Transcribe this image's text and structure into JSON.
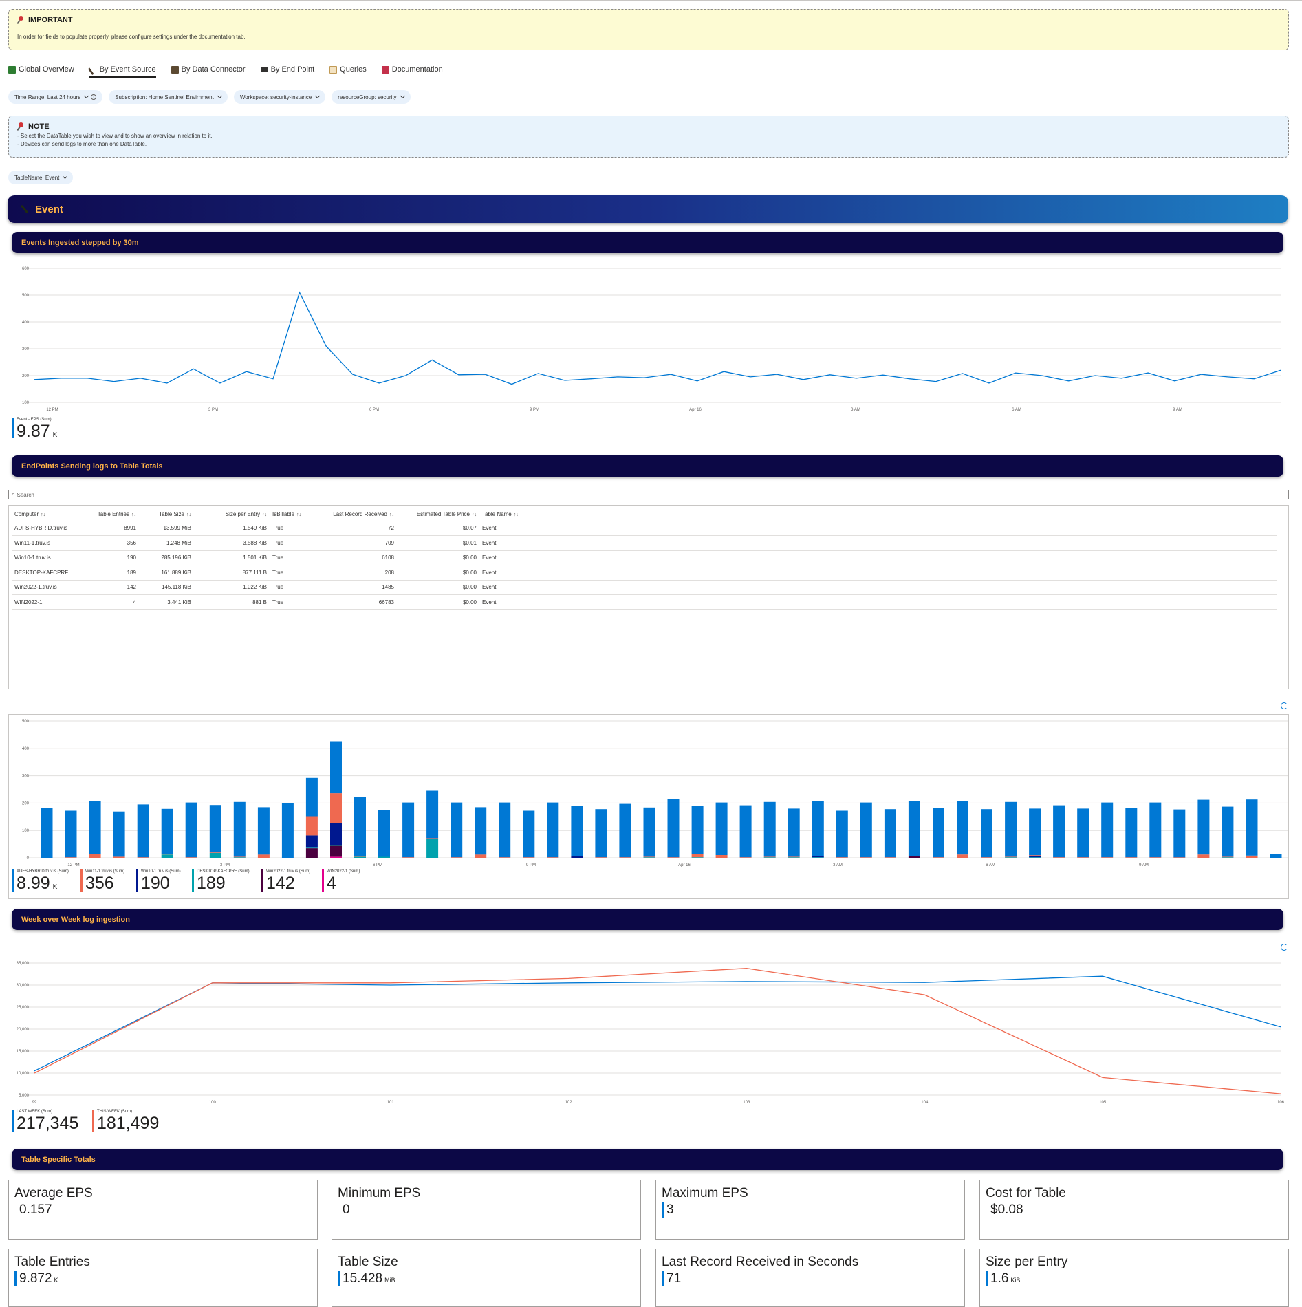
{
  "important": {
    "heading": "IMPORTANT",
    "text": "In order for fields to populate properly, please configure settings under the documentation tab."
  },
  "tabs": [
    {
      "label": "Global Overview",
      "icon": "chart-icon",
      "color": "#2e7d32"
    },
    {
      "label": "By Event Source",
      "icon": "feather-icon",
      "color": "#4a3b2a"
    },
    {
      "label": "By Data Connector",
      "icon": "connector-icon",
      "color": "#5c4a32"
    },
    {
      "label": "By End Point",
      "icon": "monitor-icon",
      "color": "#323130"
    },
    {
      "label": "Queries",
      "icon": "scroll-icon",
      "color": "#c19a55"
    },
    {
      "label": "Documentation",
      "icon": "book-icon",
      "color": "#c4314b"
    }
  ],
  "params": {
    "time_range": "Time Range: Last 24 hours",
    "subscription": "Subscription: Home Sentinel Envirnment",
    "workspace": "Workspace: security-instance",
    "resource_group": "resourceGroup: security"
  },
  "note": {
    "heading": "NOTE",
    "line1": "- Select the DataTable you wish to view and to show an overview in relation to it.",
    "line2": "- Devices can send logs to more than one DataTable."
  },
  "table_param": "TableName: Event",
  "event_title": "Event",
  "sections": {
    "ingested": "Events Ingested stepped by 30m",
    "endpoints": "EndPoints Sending logs to Table Totals",
    "week": "Week over Week log ingestion",
    "specific": "Table Specific Totals"
  },
  "colors": {
    "accent": "#0078d4",
    "section_bg": "#0c0846",
    "section_text": "#ffb347",
    "series": [
      "#0078d4",
      "#ef6950",
      "#00188f",
      "#00a2ad",
      "#4b003f",
      "#e3008c"
    ]
  },
  "chart_data": [
    {
      "type": "line",
      "title": "",
      "ylim": [
        100,
        600
      ],
      "yticks": [
        "600",
        "500",
        "400",
        "300",
        "200",
        "100"
      ],
      "xtick_labels": [
        "12 PM",
        "3 PM",
        "6 PM",
        "9 PM",
        "Apr 16",
        "3 AM",
        "6 AM",
        "9 AM"
      ],
      "series": [
        {
          "name": "Event - EPS (Sum)",
          "values": [
            185,
            190,
            190,
            178,
            190,
            172,
            225,
            172,
            215,
            188,
            510,
            310,
            205,
            172,
            200,
            258,
            203,
            205,
            168,
            208,
            182,
            188,
            195,
            192,
            205,
            180,
            215,
            195,
            205,
            185,
            203,
            190,
            202,
            188,
            178,
            208,
            172,
            210,
            200,
            180,
            200,
            190,
            210,
            180,
            205,
            195,
            188,
            220
          ]
        }
      ],
      "summary": {
        "label": "Event - EPS (Sum)",
        "value": "9.87",
        "unit": "K"
      }
    },
    {
      "type": "bar",
      "stacked": true,
      "ylim": [
        0,
        500
      ],
      "yticks": [
        "500",
        "400",
        "300",
        "200",
        "100",
        "0"
      ],
      "xtick_labels": [
        "12 PM",
        "3 PM",
        "6 PM",
        "9 PM",
        "Apr 16",
        "3 AM",
        "6 AM",
        "9 AM"
      ],
      "series": [
        {
          "name": "ADFS-HYBRID.truv.is (Sum)",
          "values": [
            183,
            170,
            193,
            165,
            193,
            165,
            200,
            173,
            200,
            173,
            200,
            140,
            190,
            215,
            172,
            200,
            173,
            200,
            173,
            200,
            170,
            200,
            182,
            176,
            195,
            180,
            212,
            176,
            192,
            190,
            200,
            176,
            200,
            170,
            200,
            176,
            200,
            180,
            195,
            176,
            200,
            170,
            190,
            178,
            200,
            180,
            200,
            175,
            200,
            183,
            205,
            15
          ]
        },
        {
          "name": "Win11-1.truv.is (Sum)",
          "values": [
            0,
            2,
            15,
            4,
            2,
            2,
            2,
            2,
            2,
            12,
            0,
            70,
            110,
            2,
            0,
            2,
            2,
            2,
            12,
            2,
            2,
            2,
            2,
            2,
            2,
            2,
            2,
            12,
            10,
            2,
            2,
            2,
            2,
            2,
            2,
            2,
            2,
            2,
            12,
            2,
            2,
            2,
            2,
            2,
            2,
            2,
            2,
            2,
            12,
            2,
            8,
            0
          ]
        },
        {
          "name": "Win10-1.truv.is (Sum)",
          "values": [
            0,
            0,
            0,
            0,
            0,
            0,
            0,
            0,
            0,
            0,
            0,
            45,
            80,
            0,
            0,
            0,
            0,
            0,
            0,
            0,
            0,
            0,
            5,
            0,
            0,
            0,
            0,
            0,
            0,
            0,
            0,
            0,
            3,
            0,
            0,
            0,
            0,
            0,
            0,
            0,
            0,
            6,
            0,
            0,
            0,
            0,
            0,
            0,
            0,
            0,
            0,
            0
          ]
        },
        {
          "name": "DESKTOP-KAFCPRF (Sum)",
          "values": [
            0,
            0,
            0,
            0,
            0,
            12,
            0,
            18,
            2,
            0,
            0,
            2,
            2,
            4,
            4,
            0,
            70,
            0,
            0,
            0,
            0,
            0,
            0,
            0,
            0,
            2,
            0,
            2,
            0,
            0,
            2,
            2,
            2,
            0,
            0,
            0,
            0,
            0,
            0,
            0,
            2,
            2,
            0,
            0,
            0,
            0,
            0,
            0,
            0,
            2,
            0,
            0
          ]
        },
        {
          "name": "Win2022-1.truv.is (Sum)",
          "values": [
            0,
            0,
            0,
            0,
            0,
            0,
            0,
            0,
            0,
            0,
            0,
            35,
            40,
            0,
            0,
            0,
            0,
            0,
            0,
            0,
            0,
            0,
            0,
            0,
            0,
            0,
            0,
            0,
            0,
            0,
            0,
            0,
            0,
            0,
            0,
            0,
            5,
            0,
            0,
            0,
            0,
            0,
            0,
            0,
            0,
            0,
            0,
            0,
            0,
            0,
            0,
            0
          ]
        },
        {
          "name": "WIN2022-1 (Sum)",
          "values": [
            0,
            0,
            0,
            0,
            0,
            0,
            0,
            0,
            0,
            0,
            0,
            0,
            4,
            0,
            0,
            0,
            0,
            0,
            0,
            0,
            0,
            0,
            0,
            0,
            0,
            0,
            0,
            0,
            0,
            0,
            0,
            0,
            0,
            0,
            0,
            0,
            0,
            0,
            0,
            0,
            0,
            0,
            0,
            0,
            0,
            0,
            0,
            0,
            0,
            0,
            0,
            0
          ]
        }
      ],
      "summary": [
        {
          "label": "ADFS-HYBRID.truv.is (Sum)",
          "value": "8.99",
          "unit": "K"
        },
        {
          "label": "Win11-1.truv.is (Sum)",
          "value": "356",
          "unit": ""
        },
        {
          "label": "Win10-1.truv.is (Sum)",
          "value": "190",
          "unit": ""
        },
        {
          "label": "DESKTOP-KAFCPRF (Sum)",
          "value": "189",
          "unit": ""
        },
        {
          "label": "Win2022-1.truv.is (Sum)",
          "value": "142",
          "unit": ""
        },
        {
          "label": "WIN2022-1 (Sum)",
          "value": "4",
          "unit": ""
        }
      ]
    },
    {
      "type": "line",
      "ylim": [
        5000,
        35000
      ],
      "yticks": [
        "35,000",
        "30,000",
        "25,000",
        "20,000",
        "15,000",
        "10,000",
        "5,000"
      ],
      "x": [
        99,
        100,
        101,
        102,
        103,
        104,
        105,
        106
      ],
      "series": [
        {
          "name": "LAST WEEK (Sum)",
          "values": [
            10500,
            30500,
            30000,
            30500,
            30800,
            30600,
            32000,
            20500
          ]
        },
        {
          "name": "THIS WEEK (Sum)",
          "values": [
            10000,
            30500,
            30500,
            31500,
            33800,
            27800,
            9000,
            5300
          ]
        }
      ],
      "summary": [
        {
          "label": "LAST WEEK (Sum)",
          "value": "217,345"
        },
        {
          "label": "THIS WEEK (Sum)",
          "value": "181,499"
        }
      ]
    }
  ],
  "table": {
    "search_placeholder": "Search",
    "columns": [
      "Computer",
      "Table Entries",
      "Table Size",
      "Size per Entry",
      "IsBillable",
      "Last Record Received",
      "Estimated Table Price",
      "Table Name"
    ],
    "rows": [
      [
        "ADFS-HYBRID.truv.is",
        "8991",
        "13.599 MiB",
        "1.549 KiB",
        "True",
        "72",
        "$0.07",
        "Event"
      ],
      [
        "Win11-1.truv.is",
        "356",
        "1.248 MiB",
        "3.588 KiB",
        "True",
        "709",
        "$0.01",
        "Event"
      ],
      [
        "Win10-1.truv.is",
        "190",
        "285.196 KiB",
        "1.501 KiB",
        "True",
        "6108",
        "$0.00",
        "Event"
      ],
      [
        "DESKTOP-KAFCPRF",
        "189",
        "161.889 KiB",
        "877.111 B",
        "True",
        "208",
        "$0.00",
        "Event"
      ],
      [
        "Win2022-1.truv.is",
        "142",
        "145.118 KiB",
        "1.022 KiB",
        "True",
        "1485",
        "$0.00",
        "Event"
      ],
      [
        "WIN2022-1",
        "4",
        "3.441 KiB",
        "881 B",
        "True",
        "66783",
        "$0.00",
        "Event"
      ]
    ]
  },
  "cards": [
    {
      "title": "Average EPS",
      "value": "0.157",
      "unit": "",
      "bar": false
    },
    {
      "title": "Minimum EPS",
      "value": "0",
      "unit": "",
      "bar": false
    },
    {
      "title": "Maximum EPS",
      "value": "3",
      "unit": "",
      "bar": true
    },
    {
      "title": "Cost for Table",
      "value": "$0.08",
      "unit": "",
      "bar": false
    },
    {
      "title": "Table Entries",
      "value": "9.872",
      "unit": "K",
      "bar": true
    },
    {
      "title": "Table Size",
      "value": "15.428",
      "unit": "MiB",
      "bar": true
    },
    {
      "title": "Last Record Received in Seconds",
      "value": "71",
      "unit": "",
      "bar": true
    },
    {
      "title": "Size per Entry",
      "value": "1.6",
      "unit": "KiB",
      "bar": true
    }
  ]
}
